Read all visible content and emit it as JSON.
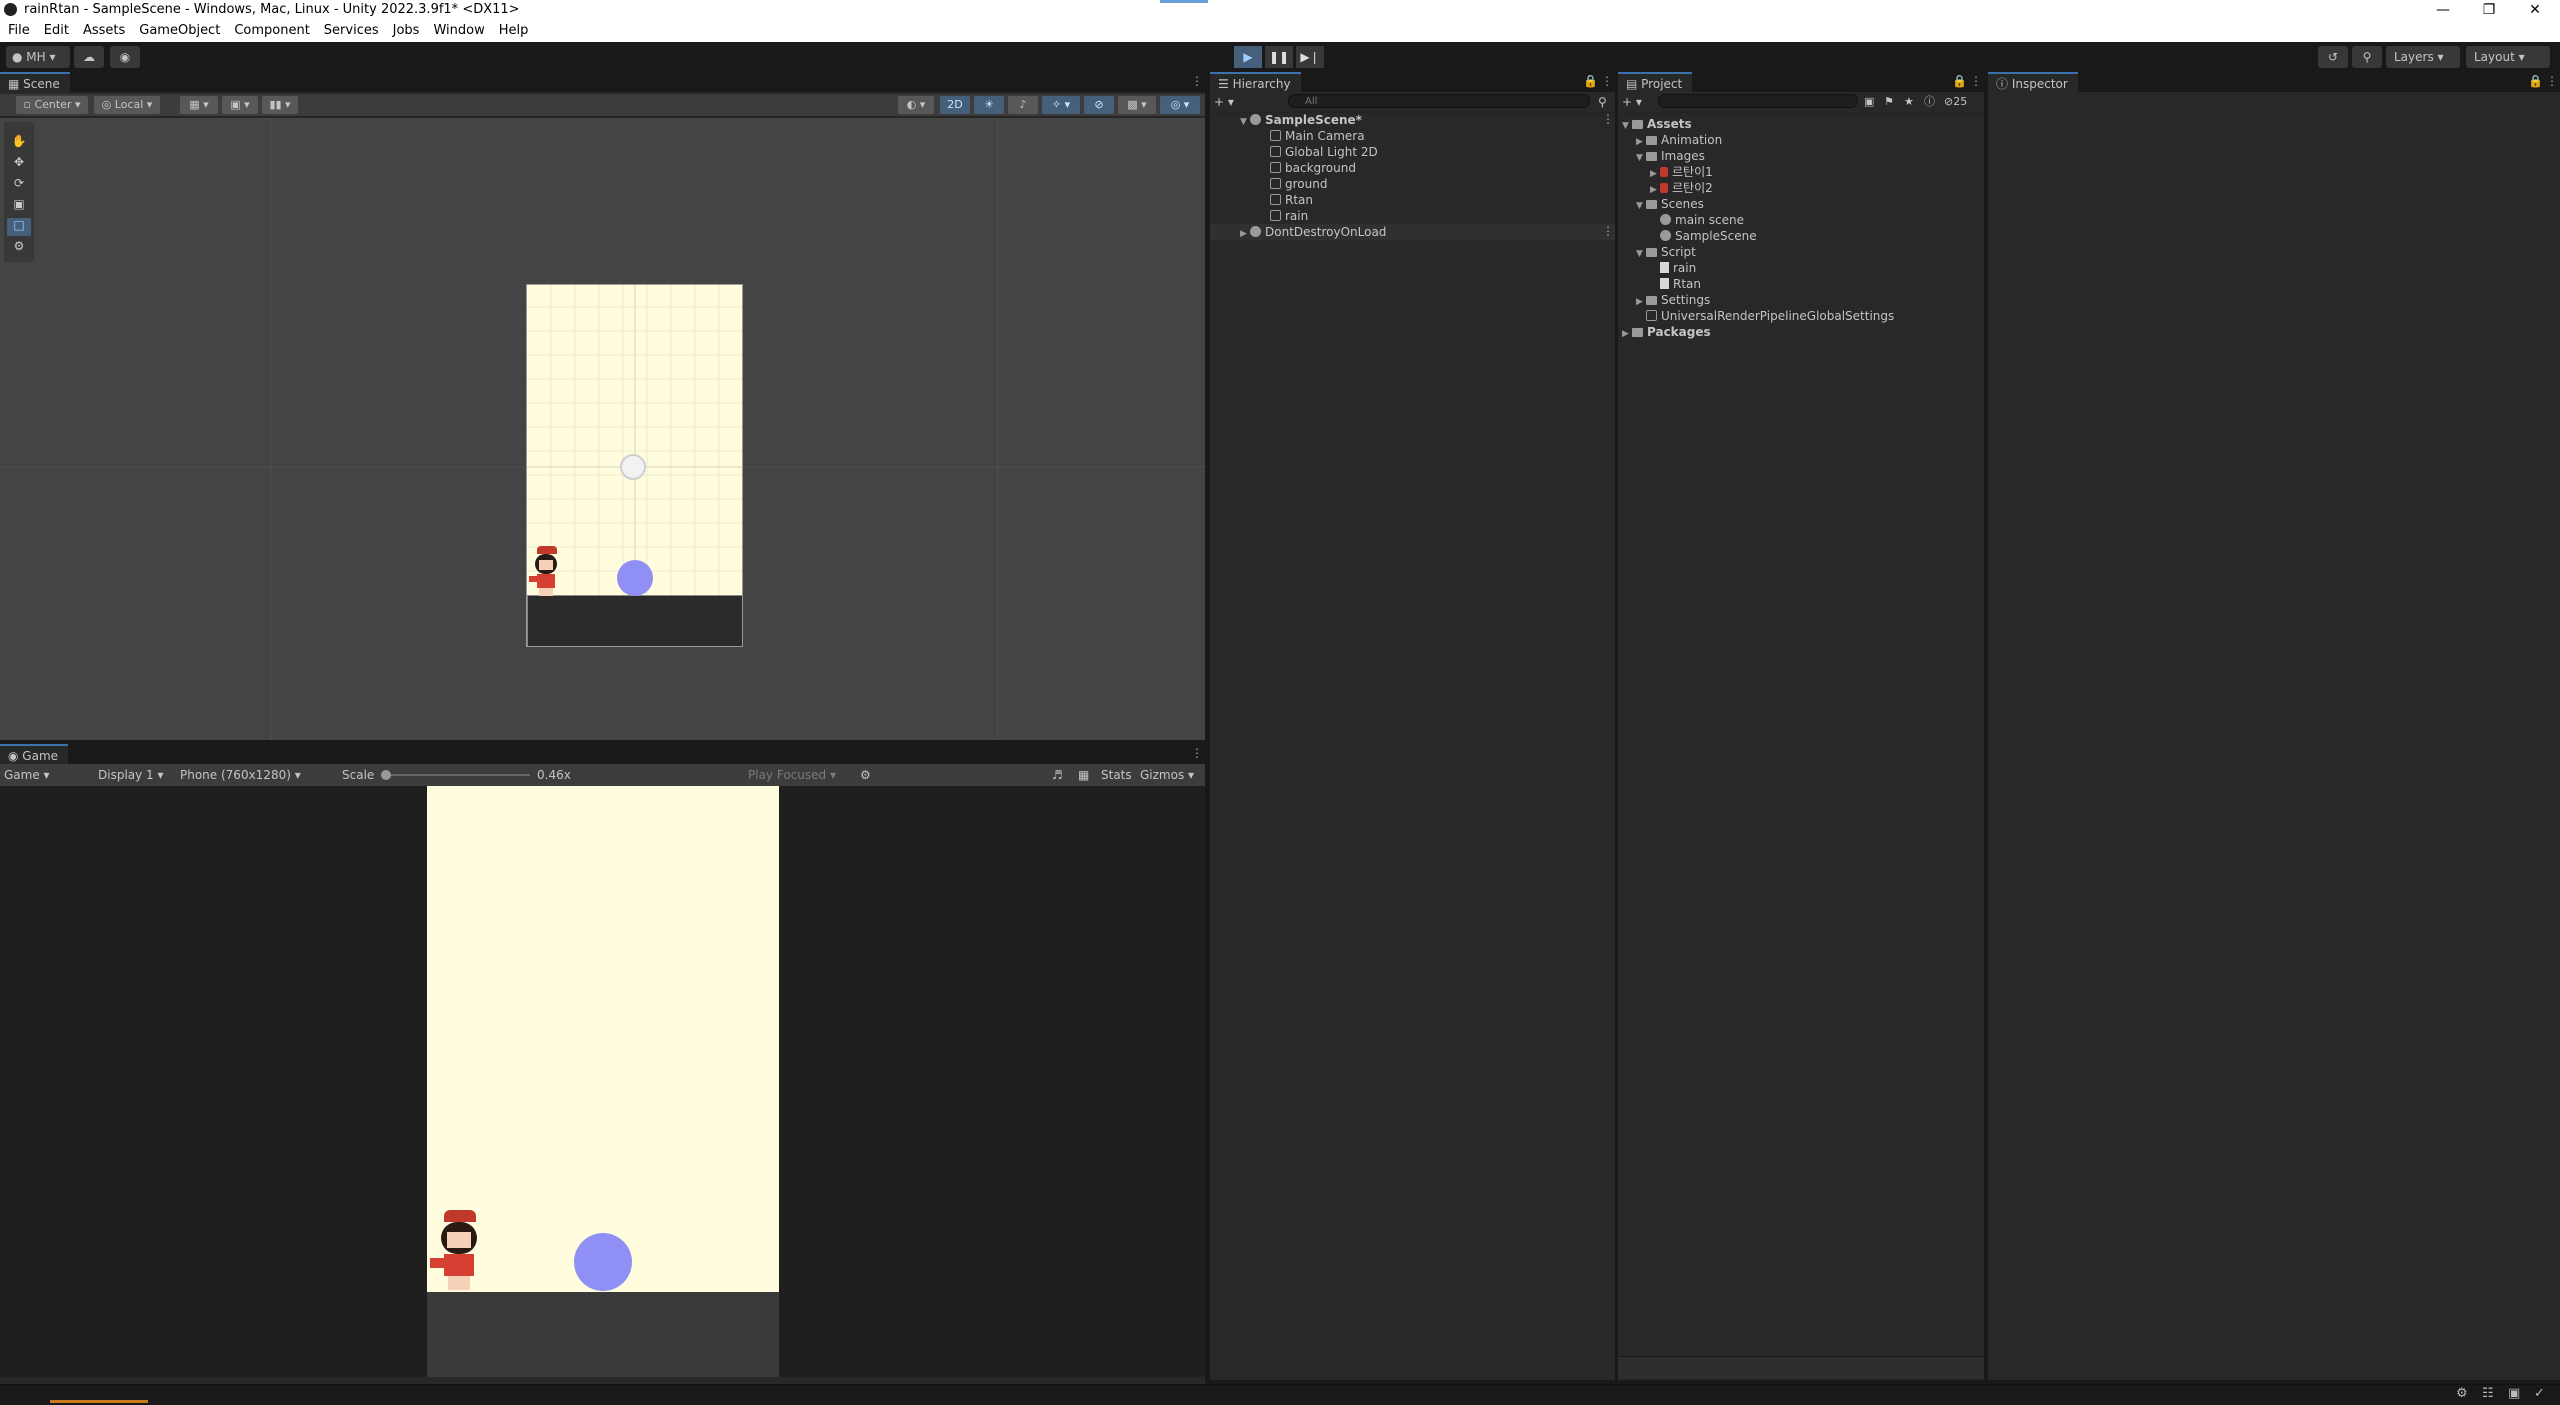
{
  "window": {
    "title": "rainRtan - SampleScene - Windows, Mac, Linux - Unity 2022.3.9f1* <DX11>"
  },
  "menu": [
    "File",
    "Edit",
    "Assets",
    "GameObject",
    "Component",
    "Services",
    "Jobs",
    "Window",
    "Help"
  ],
  "toolbar": {
    "account": "MH",
    "layers": "Layers",
    "layout": "Layout"
  },
  "scene": {
    "tab": "Scene",
    "pivot": "Center",
    "space": "Local",
    "mode2d": "2D"
  },
  "hierarchy": {
    "tab": "Hierarchy",
    "search_placeholder": "All",
    "root": "SampleScene*",
    "children": [
      "Main Camera",
      "Global Light 2D",
      "background",
      "ground",
      "Rtan",
      "rain"
    ],
    "ddol": "DontDestroyOnLoad"
  },
  "project": {
    "tab": "Project",
    "hidden_count": "25",
    "assets": "Assets",
    "animation": "Animation",
    "images": "Images",
    "image1": "르탄이1",
    "image2": "르탄이2",
    "scenes": "Scenes",
    "scene1": "main scene",
    "scene2": "SampleScene",
    "script": "Script",
    "script1": "rain",
    "script2": "Rtan",
    "settings": "Settings",
    "urp": "UniversalRenderPipelineGlobalSettings",
    "packages": "Packages"
  },
  "inspector": {
    "tab": "Inspector"
  },
  "game": {
    "tab": "Game",
    "mode": "Game",
    "display": "Display 1",
    "resolution": "Phone (760x1280)",
    "scale_label": "Scale",
    "scale_value": "0.46x",
    "play_focused": "Play Focused",
    "stats": "Stats",
    "gizmos": "Gizmos"
  },
  "colors": {
    "background_sprite": "#fffdde",
    "ground": "#2b2b2b",
    "rain": "#8f8ff5",
    "accent": "#3a72b0"
  }
}
